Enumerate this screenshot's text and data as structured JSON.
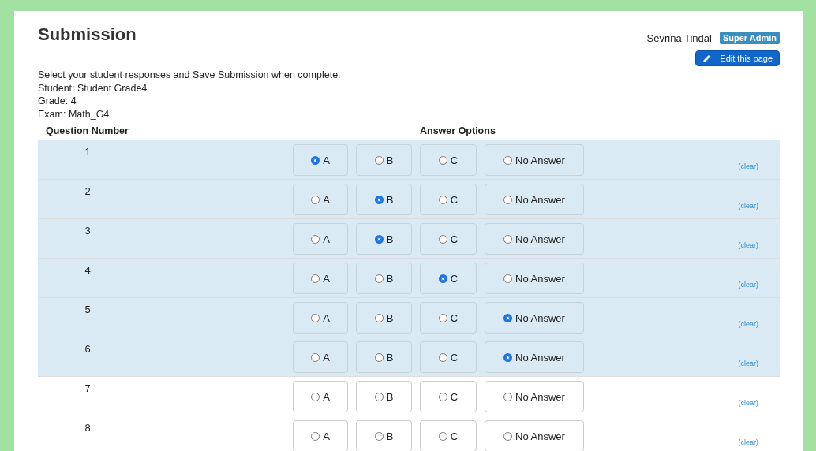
{
  "title": "Submission",
  "user": {
    "name": "Sevrina Tindal",
    "role": "Super Admin"
  },
  "edit_button": "Edit this page",
  "info": [
    "Select your student responses and Save Submission when complete.",
    "Student: Student Grade4",
    "Grade: 4",
    "Exam: Math_G4"
  ],
  "columns": [
    "Question Number",
    "Answer Options"
  ],
  "questions": [
    {
      "number": "1",
      "answered": true,
      "clear": "(clear)",
      "options": [
        {
          "label": "A",
          "selected": true
        },
        {
          "label": "B",
          "selected": false
        },
        {
          "label": "C",
          "selected": false
        },
        {
          "label": "No Answer",
          "selected": false
        }
      ]
    },
    {
      "number": "2",
      "answered": true,
      "clear": "(clear)",
      "options": [
        {
          "label": "A",
          "selected": false
        },
        {
          "label": "B",
          "selected": true
        },
        {
          "label": "C",
          "selected": false
        },
        {
          "label": "No Answer",
          "selected": false
        }
      ]
    },
    {
      "number": "3",
      "answered": true,
      "clear": "(clear)",
      "options": [
        {
          "label": "A",
          "selected": false
        },
        {
          "label": "B",
          "selected": true
        },
        {
          "label": "C",
          "selected": false
        },
        {
          "label": "No Answer",
          "selected": false
        }
      ]
    },
    {
      "number": "4",
      "answered": true,
      "clear": "(clear)",
      "options": [
        {
          "label": "A",
          "selected": false
        },
        {
          "label": "B",
          "selected": false
        },
        {
          "label": "C",
          "selected": true
        },
        {
          "label": "No Answer",
          "selected": false
        }
      ]
    },
    {
      "number": "5",
      "answered": true,
      "clear": "(clear)",
      "options": [
        {
          "label": "A",
          "selected": false
        },
        {
          "label": "B",
          "selected": false
        },
        {
          "label": "C",
          "selected": false
        },
        {
          "label": "No Answer",
          "selected": true
        }
      ]
    },
    {
      "number": "6",
      "answered": true,
      "clear": "(clear)",
      "options": [
        {
          "label": "A",
          "selected": false
        },
        {
          "label": "B",
          "selected": false
        },
        {
          "label": "C",
          "selected": false
        },
        {
          "label": "No Answer",
          "selected": true
        }
      ]
    },
    {
      "number": "7",
      "answered": false,
      "clear": "(clear)",
      "options": [
        {
          "label": "A",
          "selected": false
        },
        {
          "label": "B",
          "selected": false
        },
        {
          "label": "C",
          "selected": false
        },
        {
          "label": "No Answer",
          "selected": false
        }
      ]
    },
    {
      "number": "8",
      "answered": false,
      "clear": "(clear)",
      "options": [
        {
          "label": "A",
          "selected": false
        },
        {
          "label": "B",
          "selected": false
        },
        {
          "label": "C",
          "selected": false
        },
        {
          "label": "No Answer",
          "selected": false
        }
      ]
    }
  ]
}
